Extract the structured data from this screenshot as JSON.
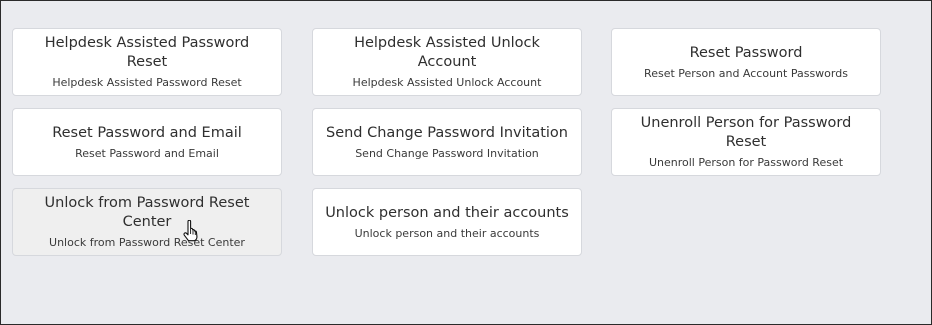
{
  "cards": [
    {
      "title": "Helpdesk Assisted Password Reset",
      "subtitle": "Helpdesk Assisted Password Reset"
    },
    {
      "title": "Helpdesk Assisted Unlock Account",
      "subtitle": "Helpdesk Assisted Unlock Account"
    },
    {
      "title": "Reset Password",
      "subtitle": "Reset Person and Account Passwords"
    },
    {
      "title": "Reset Password and Email",
      "subtitle": "Reset Password and Email"
    },
    {
      "title": "Send Change Password Invitation",
      "subtitle": "Send Change Password Invitation"
    },
    {
      "title": "Unenroll Person for Password Reset",
      "subtitle": "Unenroll Person for Password Reset"
    },
    {
      "title": "Unlock from Password Reset Center",
      "subtitle": "Unlock from Password Reset Center"
    },
    {
      "title": "Unlock person and their accounts",
      "subtitle": "Unlock person and their accounts"
    }
  ],
  "cursor_icon": "hand-pointer-icon"
}
